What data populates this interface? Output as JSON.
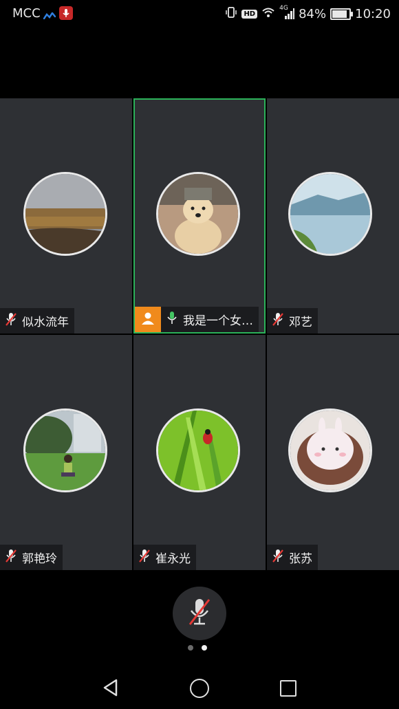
{
  "status_bar": {
    "carrier": "MCC",
    "hd": "HD",
    "network": "4G",
    "battery": "84%",
    "time": "10:20"
  },
  "participants": [
    {
      "name": "似水流年",
      "mic": "muted"
    },
    {
      "name": "我是一个女…",
      "mic": "on",
      "host": true,
      "active": true
    },
    {
      "name": "邓艺",
      "mic": "muted"
    },
    {
      "name": "郭艳玲",
      "mic": "muted"
    },
    {
      "name": "崔永光",
      "mic": "muted"
    },
    {
      "name": "张苏",
      "mic": "muted"
    }
  ],
  "controls": {
    "mic_state": "muted",
    "page_indicator": {
      "pages": 2,
      "current": 2
    }
  },
  "navigation": [
    "back-icon",
    "home-icon",
    "recent-apps-icon"
  ],
  "colors": {
    "active_border": "#2bb35a",
    "host_badge": "#f08a1c",
    "mute_red": "#e53935",
    "mic_on_green": "#43c463"
  }
}
